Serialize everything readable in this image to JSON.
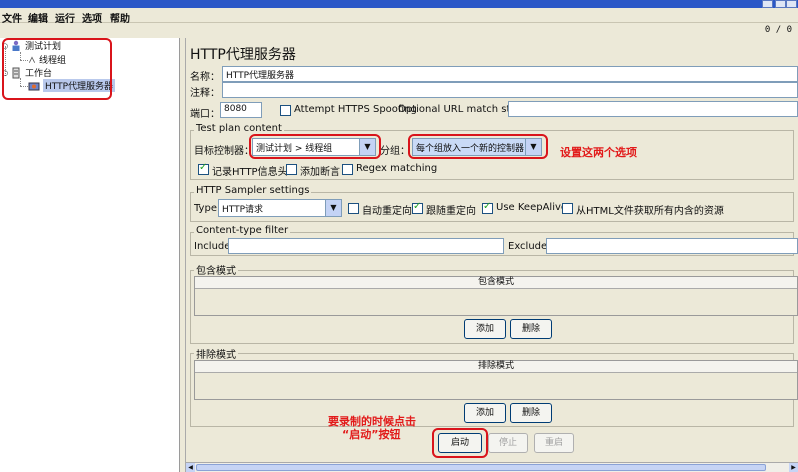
{
  "menu": [
    "文件",
    "编辑",
    "运行",
    "选项",
    "帮助"
  ],
  "counter": "0 / 0",
  "tree": [
    {
      "label": "测试计划"
    },
    {
      "label": "线程组"
    },
    {
      "label": "工作台"
    },
    {
      "label": "HTTP代理服务器"
    }
  ],
  "form": {
    "title": "HTTP代理服务器",
    "name_label": "名称：",
    "name_value": "HTTP代理服务器",
    "comment_label": "注释：",
    "port_label": "端口：",
    "port_value": "8080",
    "https_label": "Attempt HTTPS Spoofing",
    "https_checked": false,
    "url_match_label": "Optional URL match string:",
    "testplan": {
      "legend": "Test plan content",
      "target_label": "目标控制器：",
      "target_value": "测试计划 > 线程组",
      "group_label": "分组：",
      "group_value": "每个组放入一个新的控制器",
      "record_headers": "记录HTTP信息头",
      "record_headers_checked": true,
      "add_assert": "添加断言",
      "add_assert_checked": false,
      "regex": "Regex matching",
      "regex_checked": false
    },
    "sampler": {
      "legend": "HTTP Sampler settings",
      "type_label": "Type:",
      "type_value": "HTTP请求",
      "auto_redirect": "自动重定向",
      "auto_redirect_checked": false,
      "follow_redirect": "跟随重定向",
      "follow_redirect_checked": true,
      "keepalive": "Use KeepAlive",
      "keepalive_checked": true,
      "embedded": "从HTML文件获取所有内含的资源",
      "embedded_checked": false
    },
    "ctype": {
      "legend": "Content-type filter",
      "include_label": "Include:",
      "exclude_label": "Exclude:"
    },
    "include": {
      "legend": "包含模式",
      "header": "包含模式",
      "add": "添加",
      "delete": "删除"
    },
    "exclude": {
      "legend": "排除模式",
      "header": "排除模式",
      "add": "添加",
      "delete": "删除"
    },
    "start": "启动",
    "stop": "停止",
    "restart": "重启"
  },
  "annotations": {
    "set_options": "设置这两个选项",
    "record_line1": "要录制的时候点击",
    "record_line2": "“启动”按钮"
  },
  "colors": {
    "annotation": "#d9141b",
    "title_bar": "#2a57c7",
    "panel_bg": "#ece9d8"
  }
}
